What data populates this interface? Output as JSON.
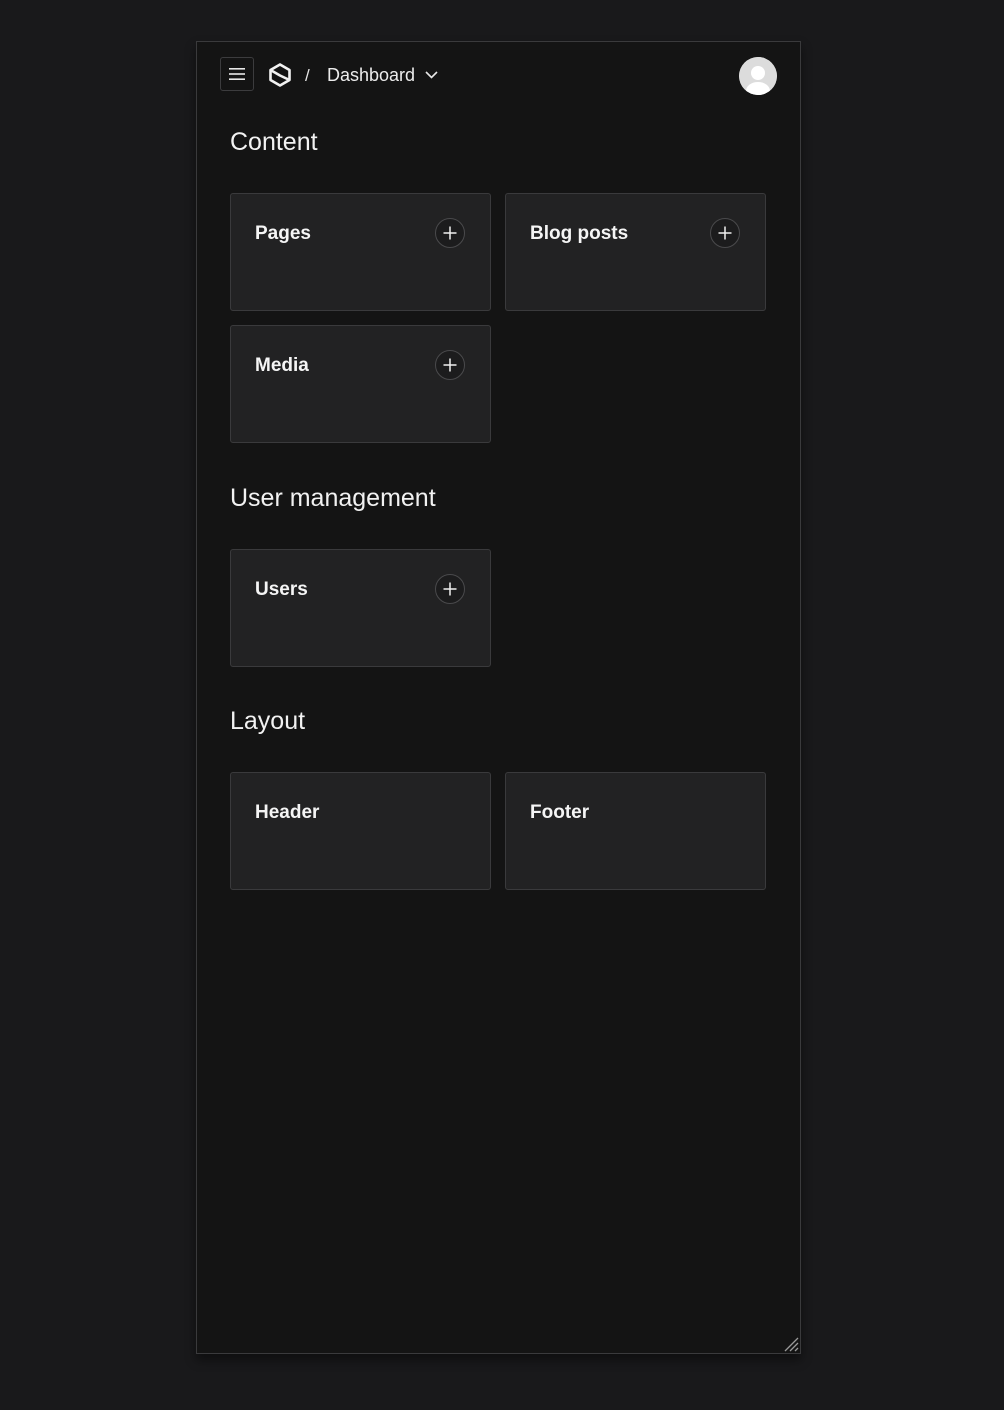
{
  "breadcrumb": {
    "separator": "/",
    "current": "Dashboard"
  },
  "sections": {
    "content": {
      "title": "Content",
      "cards": {
        "pages": "Pages",
        "blog_posts": "Blog posts",
        "media": "Media"
      }
    },
    "user_management": {
      "title": "User management",
      "cards": {
        "users": "Users"
      }
    },
    "layout": {
      "title": "Layout",
      "cards": {
        "header": "Header",
        "footer": "Footer"
      }
    }
  },
  "icons": {
    "menu": "menu-icon",
    "logo": "logo-icon",
    "chevron": "chevron-down-icon",
    "avatar": "user-avatar-icon",
    "add": "plus-icon",
    "resize": "resize-grip-icon"
  },
  "colors": {
    "background": "#19191b",
    "panel": "#141414",
    "card": "#222223",
    "border": "#3a3a3c",
    "text": "#f0f0f0"
  }
}
